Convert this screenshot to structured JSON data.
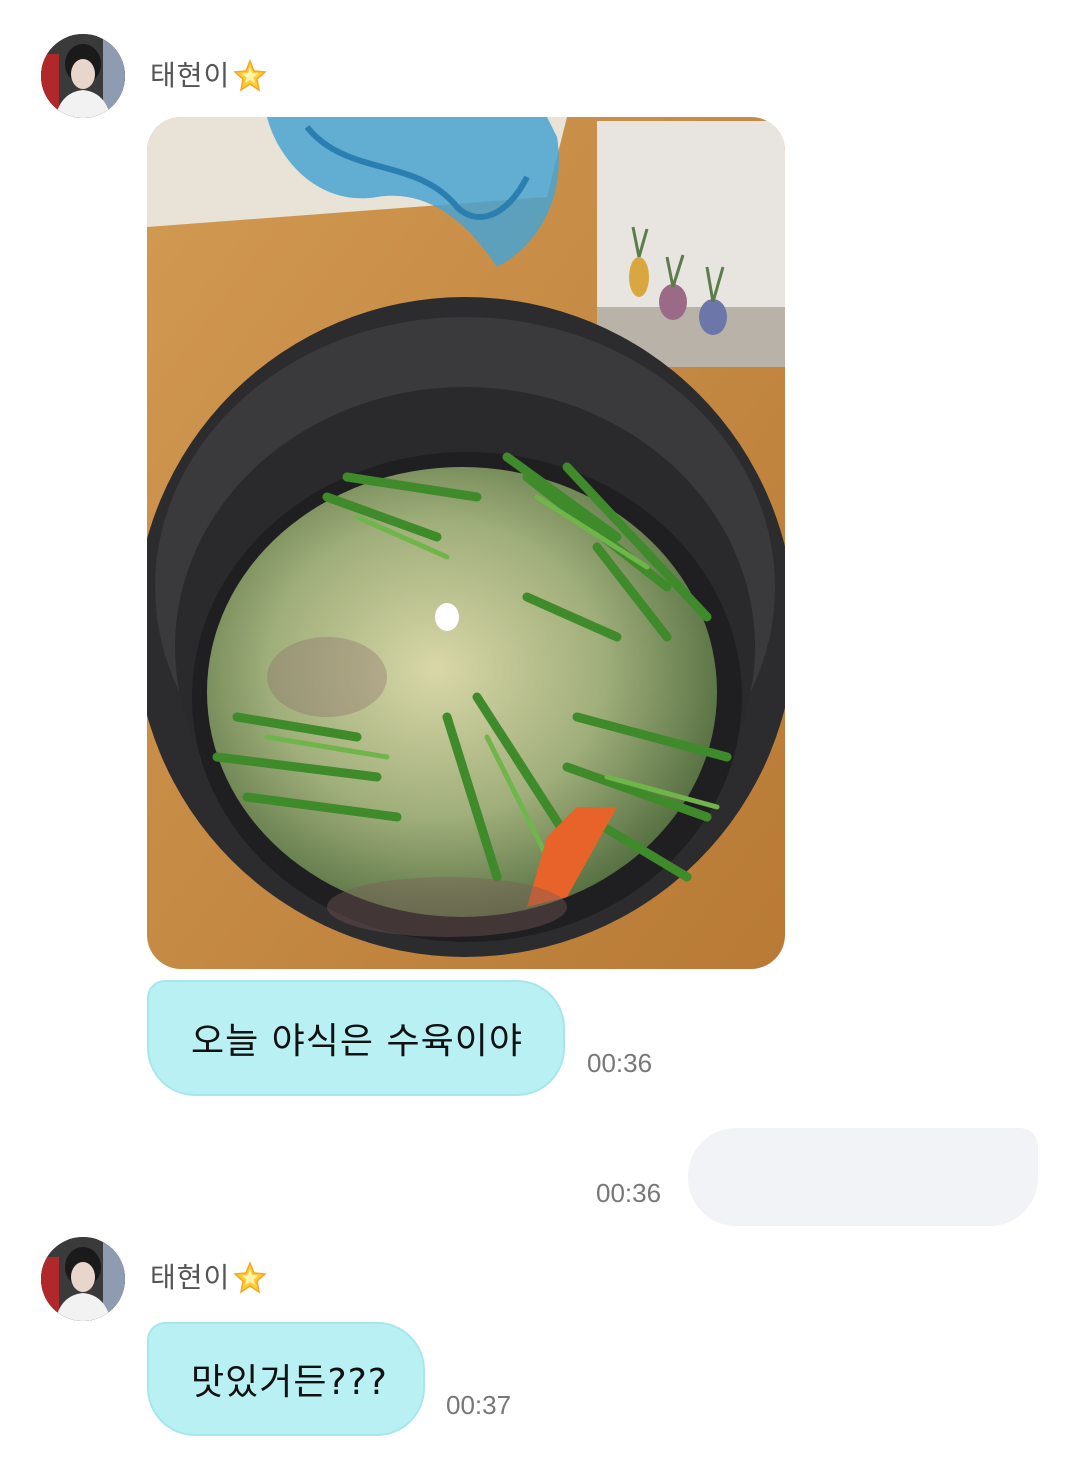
{
  "messages": [
    {
      "sender": "태현이",
      "avatar_icon": "profile-photo-avatar",
      "attachment": "photo-soup-pot",
      "text": "오늘 야식은 수육이야",
      "time": "00:36"
    },
    {
      "sender": "me",
      "text": "",
      "time": "00:36"
    },
    {
      "sender": "태현이",
      "avatar_icon": "profile-photo-avatar",
      "text": "맛있거든???",
      "time": "00:37"
    }
  ],
  "colors": {
    "incoming_bubble": "#b9f0f3",
    "outgoing_bubble": "#f2f3f6",
    "timestamp": "#777777"
  },
  "icons": {
    "star": "glowing-star-icon"
  }
}
